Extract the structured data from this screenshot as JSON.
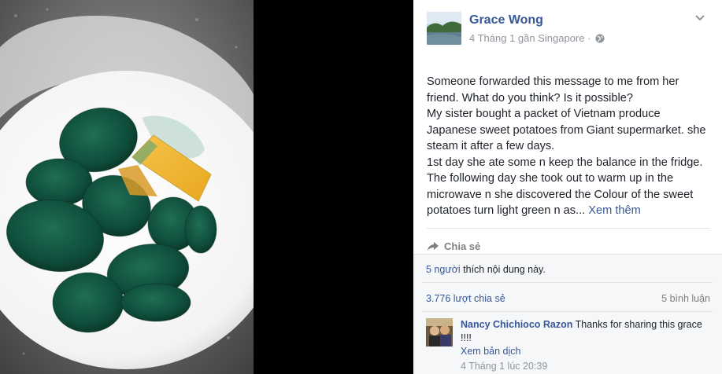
{
  "post": {
    "author": "Grace Wong",
    "meta": "4 Tháng 1 gần Singapore ·",
    "text": [
      "Someone forwarded this message to me from her friend. What do you think? Is it possible?",
      "My sister bought a packet of Vietnam produce Japanese sweet potatoes from Giant supermarket. she steam it after a few days.",
      "1st day she ate some n keep the balance in the fridge. The following day she took out to warm up in the microwave n she discovered the Colour of the sweet potatoes turn light green n as..."
    ],
    "see_more": "Xem thêm",
    "share_label": "Chia sẻ"
  },
  "stats": {
    "likes_count": "5 người",
    "likes_text": " thích nội dung này.",
    "shares": "3.776 lượt chia sẻ",
    "comments": "5 bình luận"
  },
  "comment": {
    "name": "Nancy Chichioco Razon",
    "text": " Thanks for sharing this grace !!!!",
    "translate": "Xem bản dịch",
    "time": "4 Tháng 1 lúc 20:39"
  },
  "colors": {
    "link": "#365899",
    "muted": "#90949c",
    "text": "#1d2129"
  },
  "icons": [
    "globe-icon",
    "chevron-down-icon",
    "share-icon"
  ]
}
